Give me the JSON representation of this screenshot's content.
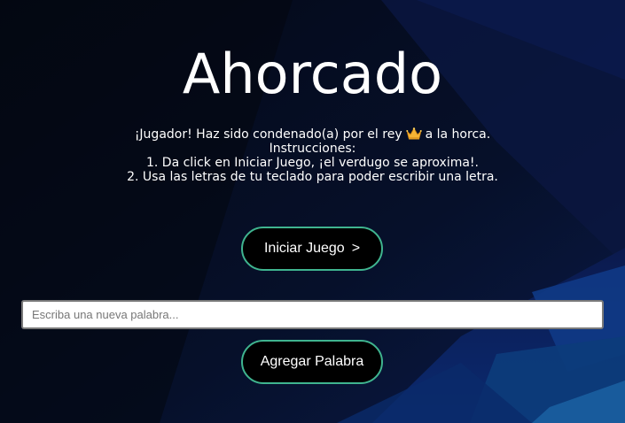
{
  "title": "Ahorcado",
  "instructions": {
    "line1_before": "¡Jugador! Haz sido condenado(a) por el rey",
    "line1_icon": "crown-icon",
    "line1_after": "a la horca.",
    "line2": "Instrucciones:",
    "line3": "1. Da click en Iniciar Juego, ¡el verdugo se aproxima!.",
    "line4": "2. Usa las letras de tu teclado para poder escribir una letra."
  },
  "start_button": {
    "label": "Iniciar Juego",
    "arrow": ">"
  },
  "word_input": {
    "placeholder": "Escriba una nueva palabra...",
    "value": ""
  },
  "add_button": {
    "label": "Agregar Palabra"
  },
  "colors": {
    "background": "#050b1c",
    "accent_border": "#3fb48f",
    "button_bg": "#000000",
    "text": "#ffffff"
  }
}
